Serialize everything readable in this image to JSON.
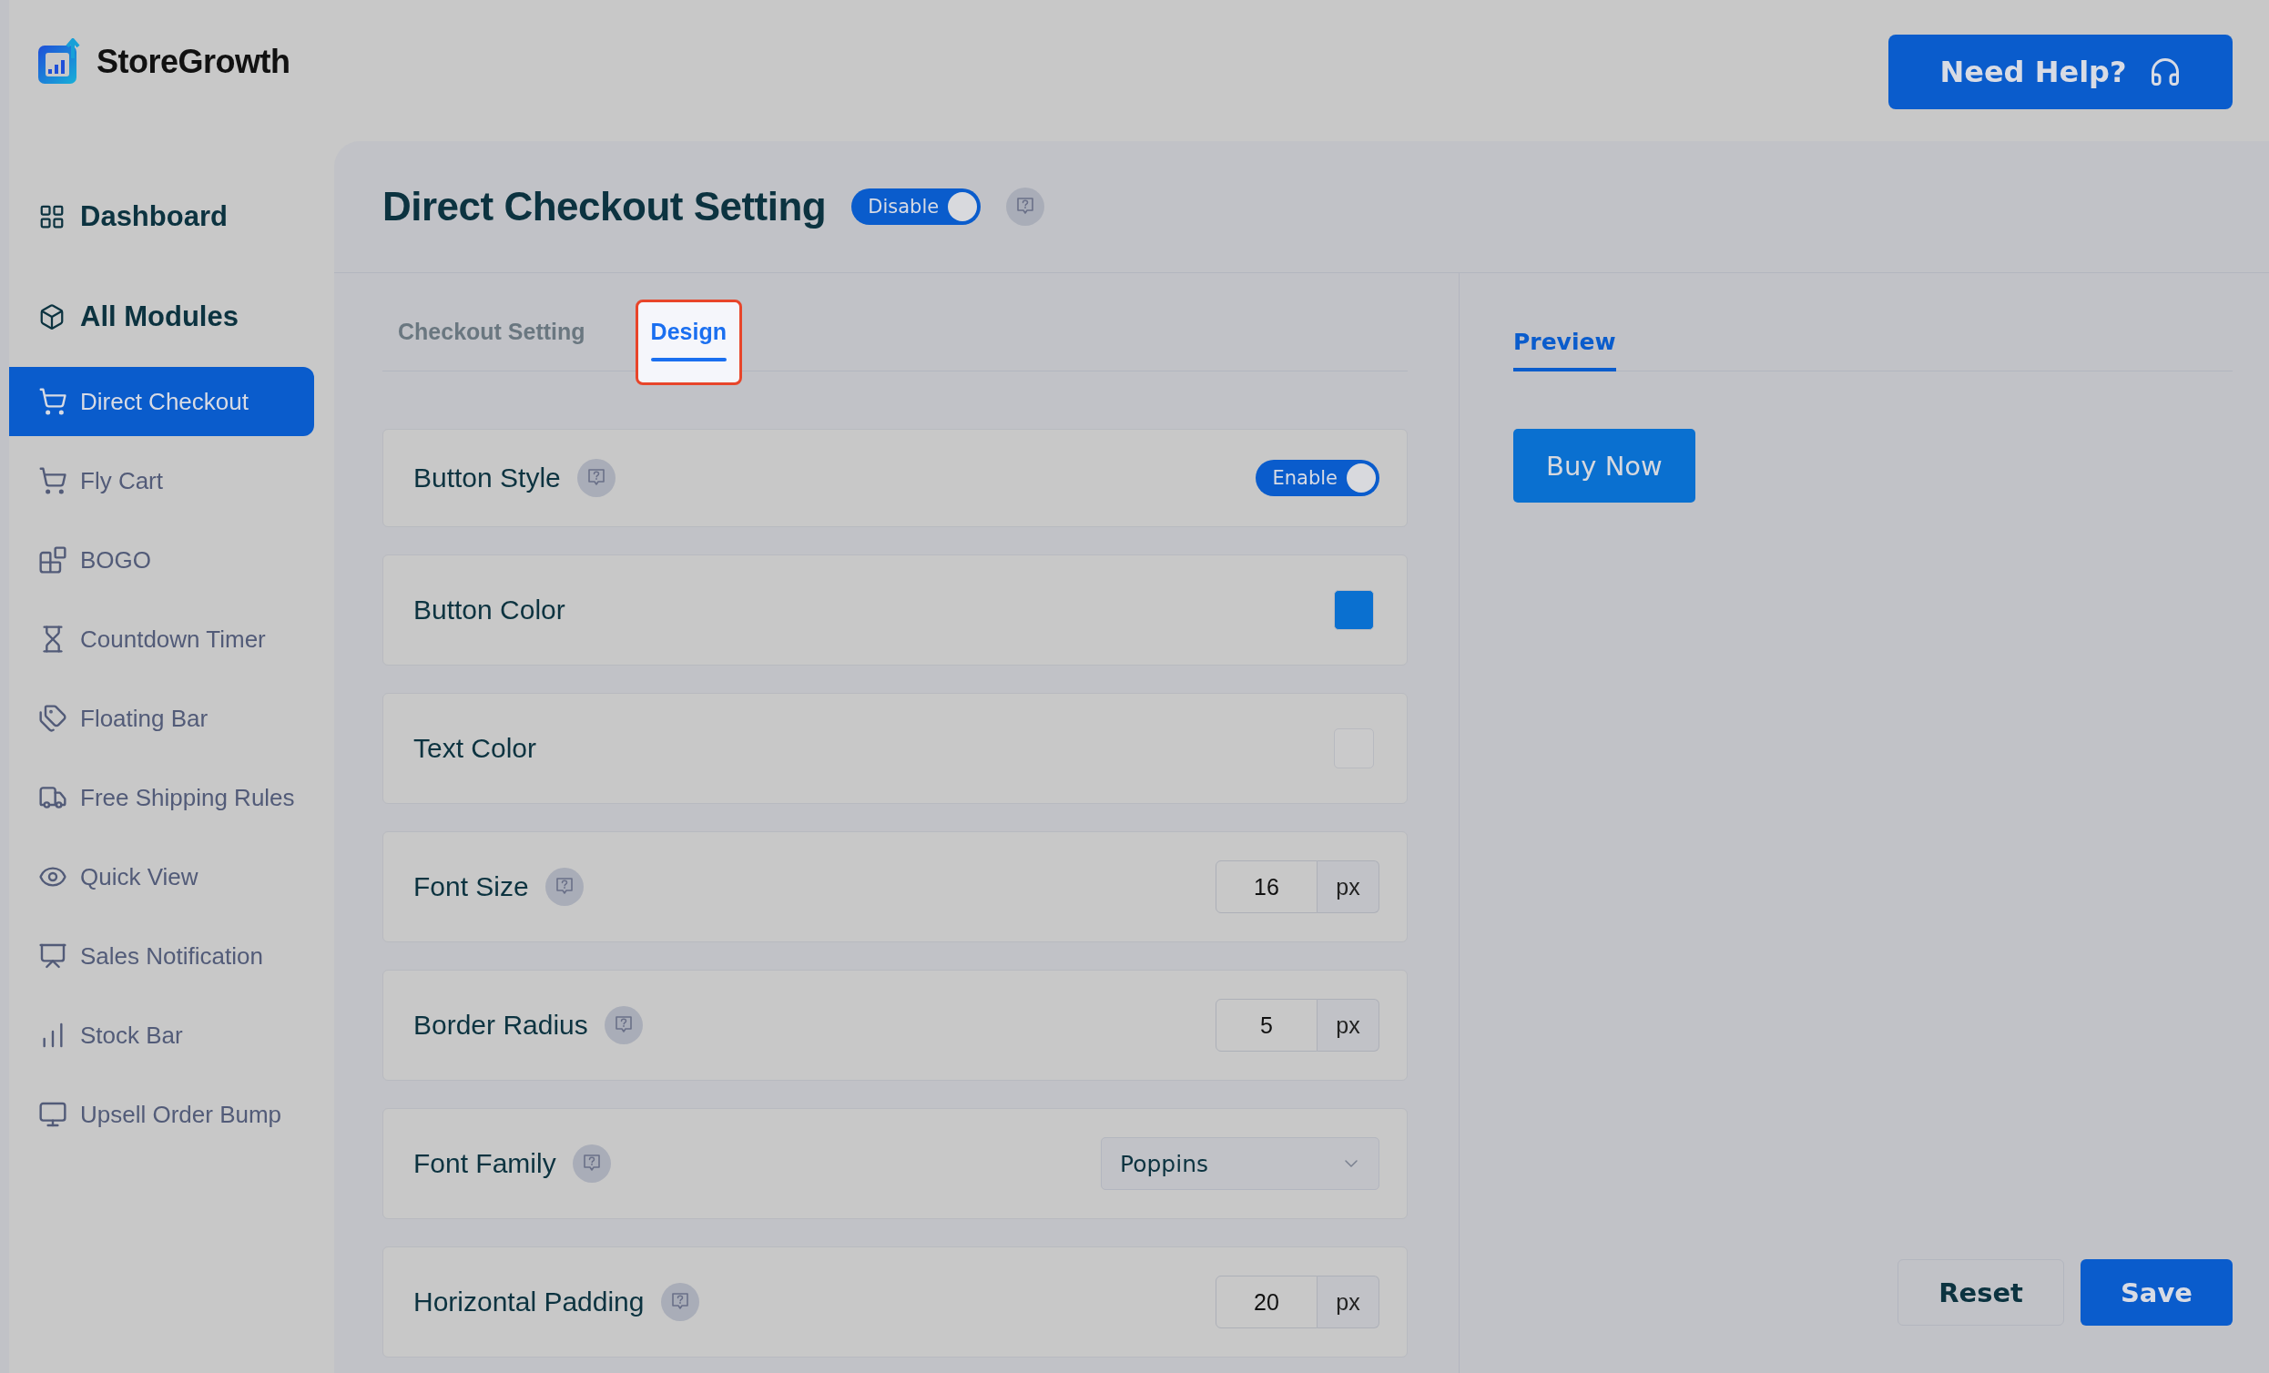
{
  "brand": {
    "name": "StoreGrowth"
  },
  "help_button": {
    "label": "Need Help?"
  },
  "sidebar": {
    "top_items": [
      {
        "label": "Dashboard"
      },
      {
        "label": "All Modules"
      }
    ],
    "items": [
      {
        "label": "Direct Checkout",
        "selected": true
      },
      {
        "label": "Fly Cart",
        "selected": false
      },
      {
        "label": "BOGO",
        "selected": false
      },
      {
        "label": "Countdown Timer",
        "selected": false
      },
      {
        "label": "Floating Bar",
        "selected": false
      },
      {
        "label": "Free Shipping Rules",
        "selected": false
      },
      {
        "label": "Quick View",
        "selected": false
      },
      {
        "label": "Sales Notification",
        "selected": false
      },
      {
        "label": "Stock Bar",
        "selected": false
      },
      {
        "label": "Upsell Order Bump",
        "selected": false
      }
    ]
  },
  "page": {
    "title": "Direct Checkout Setting",
    "toggle": {
      "label": "Disable",
      "on": true
    }
  },
  "tabs": [
    {
      "label": "Checkout Setting",
      "selected": false,
      "highlighted": false
    },
    {
      "label": "Design",
      "selected": true,
      "highlighted": true
    }
  ],
  "rows": [
    {
      "kind": "toggle",
      "label": "Button Style",
      "help": true,
      "toggle": {
        "label": "Enable",
        "on": true
      }
    },
    {
      "kind": "color",
      "label": "Button Color",
      "help": false,
      "color": "#0a70d0"
    },
    {
      "kind": "color",
      "label": "Text Color",
      "help": false,
      "color": "#cacacb"
    },
    {
      "kind": "number",
      "label": "Font Size",
      "help": true,
      "value": "16",
      "unit": "px"
    },
    {
      "kind": "number",
      "label": "Border Radius",
      "help": true,
      "value": "5",
      "unit": "px"
    },
    {
      "kind": "select",
      "label": "Font Family",
      "help": true,
      "value": "Poppins"
    },
    {
      "kind": "number",
      "label": "Horizontal Padding",
      "help": true,
      "value": "20",
      "unit": "px"
    }
  ],
  "preview": {
    "tab": {
      "label": "Preview",
      "selected": true
    },
    "button": {
      "label": "Buy Now"
    }
  },
  "actions": [
    {
      "label": "Reset",
      "kind": "secondary"
    },
    {
      "label": "Save",
      "kind": "primary"
    }
  ]
}
